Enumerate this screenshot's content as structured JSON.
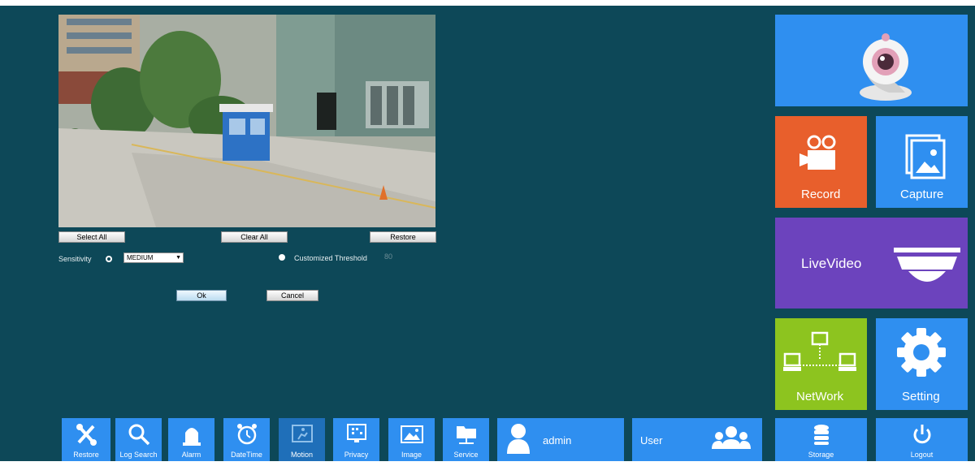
{
  "controls": {
    "select_all": "Select All",
    "clear_all": "Clear All",
    "restore": "Restore",
    "sensitivity_label": "Sensitivity",
    "sensitivity_value": "MEDIUM",
    "customized_threshold_label": "Customized Threshold",
    "threshold_value": "80",
    "ok": "Ok",
    "cancel": "Cancel"
  },
  "tiles": {
    "record": "Record",
    "capture": "Capture",
    "livevideo": "LiveVideo",
    "network": "NetWork",
    "setting": "Setting",
    "storage": "Storage",
    "logout": "Logout"
  },
  "toolbar": {
    "restore": "Restore",
    "log_search": "Log Search",
    "alarm": "Alarm",
    "datetime": "DateTime",
    "motion": "Motion",
    "privacy": "Privacy",
    "image": "Image",
    "service": "Service",
    "admin": "admin",
    "user": "User"
  },
  "colors": {
    "background": "#0d4858",
    "tile_blue": "#2f8ff0",
    "tile_orange": "#e85f2c",
    "tile_purple": "#6c43bd",
    "tile_green": "#8dc41f"
  }
}
